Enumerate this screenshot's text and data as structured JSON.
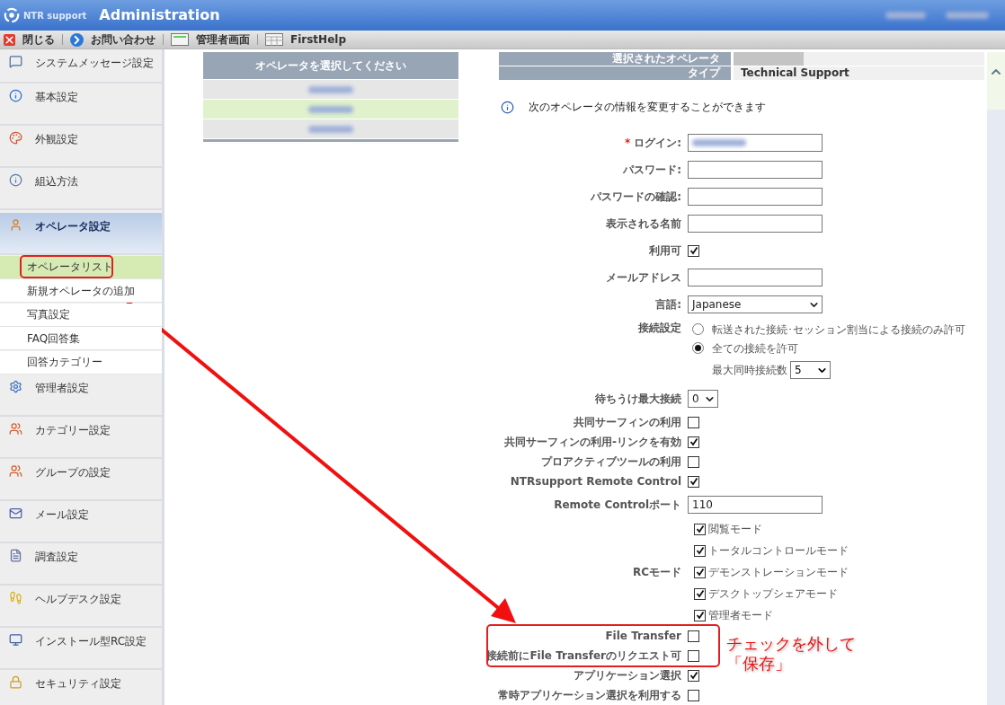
{
  "header": {
    "logo": "NTR support",
    "title": "Administration",
    "user_hidden": true
  },
  "toolbar": [
    {
      "label": "閉じる"
    },
    {
      "label": "お問い合わせ"
    },
    {
      "label": "管理者画面"
    },
    {
      "label": "FirstHelp"
    }
  ],
  "sidebar": {
    "items": [
      {
        "label": "システムメッセージ設定",
        "selected": false
      },
      {
        "label": "基本設定",
        "selected": false
      },
      {
        "label": "外観設定",
        "selected": false
      },
      {
        "label": "組込方法",
        "selected": false
      },
      {
        "label": "オペレータ設定",
        "selected": true,
        "children": [
          {
            "label": "オペレータリスト",
            "selected": true
          },
          {
            "label": "新規オペレータの追加",
            "selected": false
          },
          {
            "label": "写真設定",
            "selected": false
          },
          {
            "label": "FAQ回答集",
            "selected": false
          },
          {
            "label": "回答カテゴリー",
            "selected": false
          }
        ]
      },
      {
        "label": "管理者設定",
        "selected": false
      },
      {
        "label": "カテゴリー設定",
        "selected": false
      },
      {
        "label": "グループの設定",
        "selected": false
      },
      {
        "label": "メール設定",
        "selected": false
      },
      {
        "label": "調査設定",
        "selected": false
      },
      {
        "label": "ヘルプデスク設定",
        "selected": false
      },
      {
        "label": "インストール型RC設定",
        "selected": false
      },
      {
        "label": "セキュリティ設定",
        "selected": false
      }
    ]
  },
  "operator_list": {
    "title": "オペレータを選択してください",
    "rows": [
      {
        "selected": false
      },
      {
        "selected": true
      },
      {
        "selected": false
      }
    ]
  },
  "info_table": [
    {
      "label": "選択されたオペレータ",
      "value_hidden": true
    },
    {
      "label": "タイプ",
      "value": "Technical Support"
    }
  ],
  "info_message": "次のオペレータの情報を変更することができます",
  "form": {
    "rows": [
      {
        "kind": "text",
        "label": "ログイン:",
        "required_mark": "*",
        "value_hidden": true
      },
      {
        "kind": "text",
        "label": "パスワード:"
      },
      {
        "kind": "text",
        "label": "パスワードの確認:"
      },
      {
        "kind": "text",
        "label": "表示される名前"
      },
      {
        "kind": "checkbox",
        "label": "利用可",
        "checked": true
      },
      {
        "kind": "text",
        "label": "メールアドレス"
      },
      {
        "kind": "select",
        "label": "言語:",
        "value": "Japanese"
      },
      {
        "kind": "radio",
        "label": "接続設定",
        "options": [
          {
            "label": "転送された接続･セッション割当による接続のみ許可",
            "selected": false
          },
          {
            "label": "全ての接続を許可",
            "selected": true
          }
        ],
        "sub_label": "最大同時接続数",
        "sub_value": "5"
      },
      {
        "kind": "small_select",
        "label": "待ちうけ最大接続",
        "value": "0"
      },
      {
        "kind": "checkbox",
        "label": "共同サーフィンの利用",
        "checked": false
      },
      {
        "kind": "checkbox",
        "label": "共同サーフィンの利用-リンクを有効",
        "checked": true
      },
      {
        "kind": "checkbox",
        "label": "プロアクティブツールの利用",
        "checked": false
      },
      {
        "kind": "checkbox",
        "label": "NTRsupport Remote Control",
        "checked": true
      },
      {
        "kind": "text",
        "label": "Remote Controlポート",
        "value": "110"
      },
      {
        "kind": "checklist",
        "label": "RCモード",
        "items": [
          {
            "label": "閲覧モード",
            "checked": true
          },
          {
            "label": "トータルコントロールモード",
            "checked": true
          },
          {
            "label": "デモンストレーションモード",
            "checked": true
          },
          {
            "label": "デスクトップシェアモード",
            "checked": true
          },
          {
            "label": "管理者モード",
            "checked": true
          }
        ]
      },
      {
        "kind": "checkbox",
        "label": "File Transfer",
        "checked": false,
        "highlighted": true
      },
      {
        "kind": "checkbox",
        "label": "接続前にFile Transferのリクエスト可",
        "checked": false,
        "highlighted": true
      },
      {
        "kind": "checkbox",
        "label": "アプリケーション選択",
        "checked": true
      },
      {
        "kind": "checkbox",
        "label": "常時アプリケーション選択を利用する",
        "checked": false
      }
    ]
  },
  "annotation": {
    "lines": [
      "チェックを外して",
      "「保存」"
    ]
  }
}
